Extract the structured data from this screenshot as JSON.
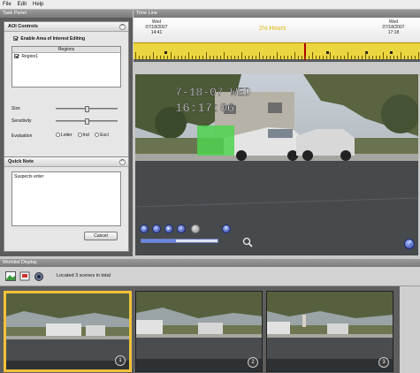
{
  "menu": [
    "File",
    "Edit",
    "Help"
  ],
  "task_panel": {
    "title": "Task Panel",
    "aoi": {
      "title": "AOI Controls",
      "enable_label": "Enable Area of Interest Editing",
      "enable_checked": true,
      "regions_header": "Regions",
      "regions": [
        {
          "name": "Region1",
          "checked": true
        }
      ],
      "size_label": "Size",
      "sensitivity_label": "Sensitivity",
      "size_value": 0.5,
      "sensitivity_value": 0.5,
      "evaluation_label": "Evaluation",
      "evaluation_options": [
        "Loiter",
        "Incl",
        "Excl"
      ]
    },
    "quick_note": {
      "title": "Quick Note",
      "text": "Suspects enter",
      "cancel_label": "Cancel"
    }
  },
  "timeline": {
    "title": "Time Line",
    "start": {
      "day": "Wed",
      "date": "07/18/2007",
      "time": "14:41"
    },
    "end": {
      "day": "Wed",
      "date": "07/18/2007",
      "time": "17:18"
    },
    "duration": "2½ Hours"
  },
  "video": {
    "overlay_text": [
      "7-18-07 WED",
      "16:17:06"
    ],
    "playback_progress": 0.45
  },
  "worklist": {
    "title": "Worklist Display",
    "status": "Located 3 scenes in total",
    "thumbnails": [
      {
        "number": "1",
        "selected": true
      },
      {
        "number": "2",
        "selected": false
      },
      {
        "number": "3",
        "selected": false
      }
    ]
  },
  "colors": {
    "ruler": "#ecd640",
    "selection": "#f2c23a",
    "aoi_region": "#4fd24f",
    "duration_text": "#e0b400"
  }
}
